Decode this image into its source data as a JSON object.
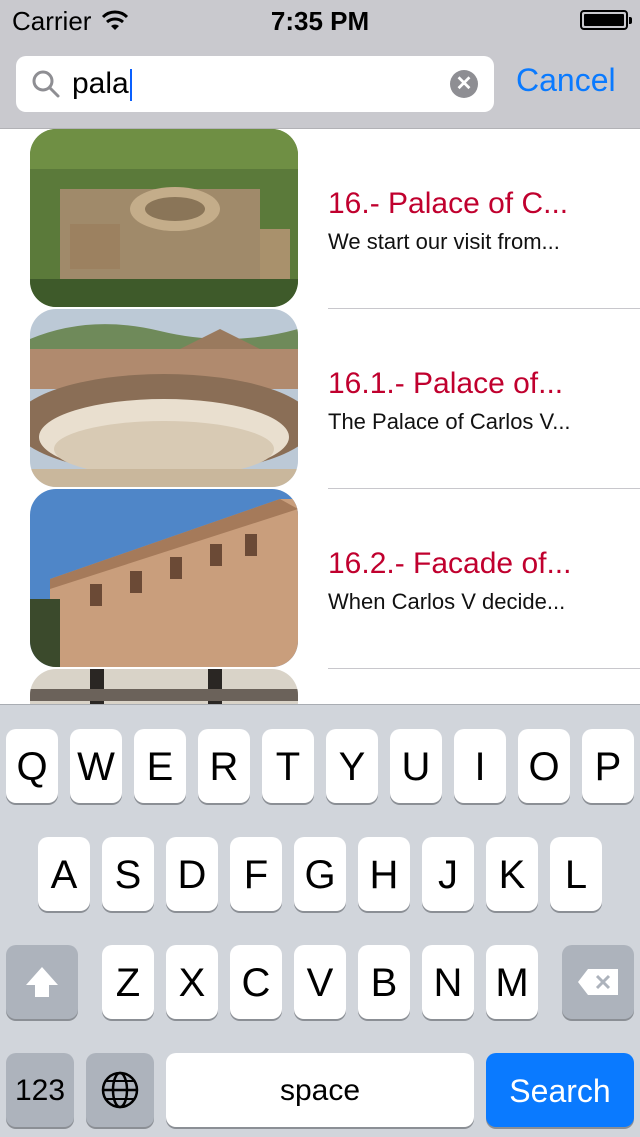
{
  "status_bar": {
    "carrier": "Carrier",
    "time": "7:35 PM"
  },
  "search": {
    "query": "pala",
    "cancel_label": "Cancel"
  },
  "results": [
    {
      "title": "16.- Palace of C...",
      "subtitle": "We start our visit from..."
    },
    {
      "title": "16.1.- Palace of...",
      "subtitle": "The Palace of Carlos V..."
    },
    {
      "title": "16.2.- Facade of...",
      "subtitle": "When Carlos V decide..."
    },
    {
      "title": "",
      "subtitle": ""
    }
  ],
  "keyboard": {
    "row1": [
      "Q",
      "W",
      "E",
      "R",
      "T",
      "Y",
      "U",
      "I",
      "O",
      "P"
    ],
    "row2": [
      "A",
      "S",
      "D",
      "F",
      "G",
      "H",
      "J",
      "K",
      "L"
    ],
    "row3": [
      "Z",
      "X",
      "C",
      "V",
      "B",
      "N",
      "M"
    ],
    "numbers_label": "123",
    "space_label": "space",
    "search_label": "Search"
  },
  "colors": {
    "title_red": "#c0002e",
    "accent_blue": "#0a7aff",
    "header_gray": "#c9c9ce",
    "keyboard_bg": "#d1d5db"
  },
  "icons": [
    "wifi-icon",
    "battery-icon",
    "search-icon",
    "clear-icon",
    "shift-icon",
    "backspace-icon",
    "globe-icon"
  ]
}
